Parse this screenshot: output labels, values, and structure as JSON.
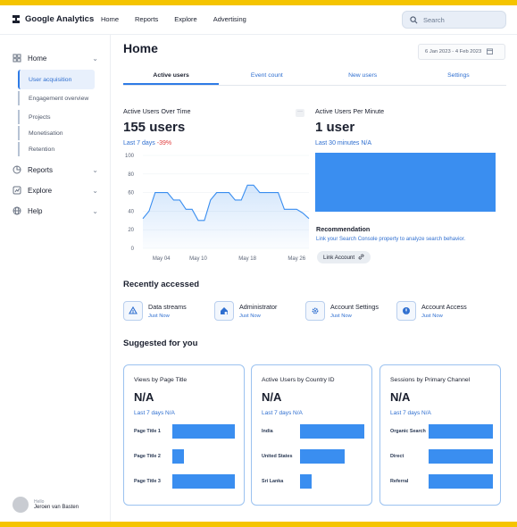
{
  "brand": {
    "name": "Google Analytics"
  },
  "topnav": [
    "Home",
    "Reports",
    "Explore",
    "Advertising"
  ],
  "search": {
    "placeholder": "Search"
  },
  "sidebar": {
    "home": "Home",
    "subitems": [
      "User acquisition",
      "Engagement overview",
      "Projects",
      "Monetisation",
      "Retention"
    ],
    "reports": "Reports",
    "explore": "Explore",
    "help": "Help",
    "user": {
      "hello": "Hello",
      "name": "Jeroen van Basten"
    }
  },
  "page": {
    "title": "Home",
    "date_range": "6 Jan 2023 - 4 Feb 2023"
  },
  "tabs": [
    "Active users",
    "Event count",
    "New users",
    "Settings"
  ],
  "active_users": {
    "title": "Active Users Over Time",
    "value": "155 users",
    "period": "Last 7 days",
    "change": "-39%"
  },
  "per_minute": {
    "title": "Active Users Per Minute",
    "value": "1 user",
    "period": "Last 30 minutes N/A"
  },
  "recommendation": {
    "title": "Recommendation",
    "text": "Link your Search Console property to analyze search behavior.",
    "button": "Link Account"
  },
  "recent": {
    "heading": "Recently accessed",
    "items": [
      {
        "title": "Data streams",
        "sub": "Just Now",
        "icon": "stream-icon"
      },
      {
        "title": "Administrator",
        "sub": "Just Now",
        "icon": "admin-icon"
      },
      {
        "title": "Account Settings",
        "sub": "Just Now",
        "icon": "gear-icon"
      },
      {
        "title": "Account Access",
        "sub": "Just Now",
        "icon": "shield-icon"
      }
    ]
  },
  "suggested": {
    "heading": "Suggested for you",
    "cards": [
      {
        "title": "Views by Page Title",
        "value": "N/A",
        "period": "Last 7 days N/A",
        "rows": [
          {
            "label": "Page Title 1",
            "level": 0.61
          },
          {
            "label": "Page Title 2",
            "level": 0.11
          },
          {
            "label": "Page Title 3",
            "level": 0.61
          }
        ]
      },
      {
        "title": "Active Users by Country ID",
        "value": "N/A",
        "period": "Last 7 days N/A",
        "rows": [
          {
            "label": "India",
            "level": 0.73
          },
          {
            "label": "United States",
            "level": 0.44
          },
          {
            "label": "Sri Lanka",
            "level": 0.11
          }
        ]
      },
      {
        "title": "Sessions by Primary Channel",
        "value": "N/A",
        "period": "Last 7 days N/A",
        "rows": [
          {
            "label": "Organic Search",
            "level": 0.69
          },
          {
            "label": "Direct",
            "level": 0.68
          },
          {
            "label": "Referral",
            "level": 0.66
          }
        ]
      }
    ]
  },
  "chart_data": {
    "type": "area",
    "title": "Active Users Over Time",
    "yticks": [
      0,
      20,
      40,
      60,
      80,
      100
    ],
    "ylim": [
      0,
      100
    ],
    "xtick_labels": [
      "May 04",
      "May 10",
      "May 18",
      "May 26"
    ],
    "x": [
      "May 01",
      "May 02",
      "May 03",
      "May 04",
      "May 05",
      "May 06",
      "May 07",
      "May 08",
      "May 09",
      "May 10",
      "May 11",
      "May 12",
      "May 13",
      "May 14",
      "May 15",
      "May 16",
      "May 17",
      "May 18",
      "May 19",
      "May 20",
      "May 21",
      "May 22",
      "May 23",
      "May 24",
      "May 25",
      "May 26",
      "May 27",
      "May 28"
    ],
    "values": [
      32,
      40,
      60,
      60,
      60,
      52,
      52,
      42,
      42,
      30,
      30,
      52,
      60,
      60,
      60,
      52,
      52,
      68,
      68,
      60,
      60,
      60,
      60,
      42,
      42,
      42,
      38,
      32
    ]
  },
  "colors": {
    "accent": "#2f7be6",
    "bar": "#3a8ef0",
    "negative": "#e03c3c",
    "frame": "#f5c400"
  }
}
